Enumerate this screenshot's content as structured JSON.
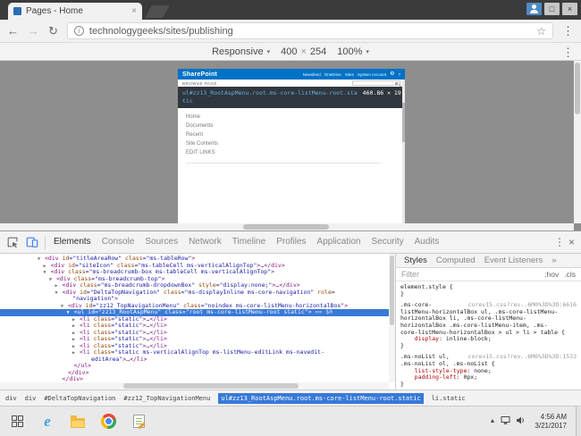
{
  "browser": {
    "tab_title": "Pages - Home",
    "tab_close": "×",
    "url": "technologygeeks/sites/publishing",
    "back": "←",
    "forward": "→",
    "reload": "↻",
    "info_glyph": "i",
    "star": "☆",
    "menu": "⋮",
    "maximize": "□",
    "close": "×"
  },
  "device_toolbar": {
    "mode": "Responsive",
    "caret": "▾",
    "width": "400",
    "times": "×",
    "height": "254",
    "zoom": "100%",
    "menu": "⋮"
  },
  "page": {
    "brand": "SharePoint",
    "suite_links": [
      "Newsfeed",
      "OneDrive",
      "Sites"
    ],
    "account": "System Account",
    "gear": "⚙",
    "help": "?",
    "ribbon_left": "BROWSE  PAGE",
    "nav_items": [
      "Home",
      "Documents",
      "Recent",
      "Site Contents",
      "EDIT LINKS"
    ],
    "tooltip": {
      "selector_line1": "ul#zz13_RootAspMenu.root.ms-core-listMenu-root.sta",
      "selector_line2": "tic",
      "dimensions": "460.86 × 19"
    }
  },
  "devtools": {
    "tabs": [
      "Elements",
      "Console",
      "Sources",
      "Network",
      "Timeline",
      "Profiles",
      "Application",
      "Security",
      "Audits"
    ],
    "selected_tab": "Elements",
    "menu": "⋮",
    "close": "×",
    "tree": [
      {
        "d": 0,
        "a": "▼",
        "s": [
          [
            "tg",
            "<div "
          ],
          [
            "at",
            "id"
          ],
          [
            "vl",
            "=\"titleAreaRow\""
          ],
          [
            "at",
            " class"
          ],
          [
            "vl",
            "=\"ms-tableRow\""
          ],
          [
            "tg",
            ">"
          ]
        ]
      },
      {
        "d": 1,
        "a": "▶",
        "s": [
          [
            "tg",
            "<div "
          ],
          [
            "at",
            "id"
          ],
          [
            "vl",
            "=\"siteIcon\""
          ],
          [
            "at",
            " class"
          ],
          [
            "vl",
            "=\"ms-tableCell ms-verticalAlignTop\""
          ],
          [
            "tg",
            ">"
          ],
          [
            "tx",
            "…"
          ],
          [
            "tg",
            "</div>"
          ]
        ]
      },
      {
        "d": 1,
        "a": "▼",
        "s": [
          [
            "tg",
            "<div "
          ],
          [
            "at",
            "class"
          ],
          [
            "vl",
            "=\"ms-breadcrumb-box ms-tableCell ms-verticalAlignTop\""
          ],
          [
            "tg",
            ">"
          ]
        ]
      },
      {
        "d": 2,
        "a": "▼",
        "s": [
          [
            "tg",
            "<div "
          ],
          [
            "at",
            "class"
          ],
          [
            "vl",
            "=\"ms-breadcrumb-top\""
          ],
          [
            "tg",
            ">"
          ]
        ]
      },
      {
        "d": 3,
        "a": "▶",
        "s": [
          [
            "tg",
            "<div "
          ],
          [
            "at",
            "class"
          ],
          [
            "vl",
            "=\"ms-breadcrumb-dropdownBox\""
          ],
          [
            "at",
            " style"
          ],
          [
            "vl",
            "=\"display:none;\""
          ],
          [
            "tg",
            ">"
          ],
          [
            "tx",
            "…"
          ],
          [
            "tg",
            "</div>"
          ]
        ]
      },
      {
        "d": 3,
        "a": "▼",
        "s": [
          [
            "tg",
            "<div "
          ],
          [
            "at",
            "id"
          ],
          [
            "vl",
            "=\"DeltaTopNavigation\""
          ],
          [
            "at",
            " class"
          ],
          [
            "vl",
            "=\"ms-displayInline ms-core-navigation\""
          ],
          [
            "at",
            " role"
          ],
          [
            "tx",
            "="
          ]
        ]
      },
      {
        "d": 4.8,
        "a": "",
        "s": [
          [
            "vl",
            "\"navigation\""
          ],
          [
            "tg",
            ">"
          ]
        ]
      },
      {
        "d": 4,
        "a": "▼",
        "s": [
          [
            "tg",
            "<div "
          ],
          [
            "at",
            "id"
          ],
          [
            "vl",
            "=\"zz12_TopNavigationMenu\""
          ],
          [
            "at",
            " class"
          ],
          [
            "vl",
            "=\"noindex ms-core-listMenu-horizontalBox\""
          ],
          [
            "tg",
            ">"
          ]
        ]
      },
      {
        "d": 5,
        "a": "▼",
        "sel": true,
        "s": [
          [
            "tg",
            "<ul "
          ],
          [
            "at",
            "id"
          ],
          [
            "vl",
            "=\"zz13_RootAspMenu\""
          ],
          [
            "at",
            " class"
          ],
          [
            "vl",
            "=\"root ms-core-listMenu-root static\""
          ],
          [
            "tg",
            ">"
          ],
          [
            "mk",
            " == $0"
          ]
        ]
      },
      {
        "d": 6,
        "a": "▶",
        "s": [
          [
            "tg",
            "<li "
          ],
          [
            "at",
            "class"
          ],
          [
            "vl",
            "=\"static\""
          ],
          [
            "tg",
            ">"
          ],
          [
            "tx",
            "…"
          ],
          [
            "tg",
            "</li>"
          ]
        ]
      },
      {
        "d": 6,
        "a": "▶",
        "s": [
          [
            "tg",
            "<li "
          ],
          [
            "at",
            "class"
          ],
          [
            "vl",
            "=\"static\""
          ],
          [
            "tg",
            ">"
          ],
          [
            "tx",
            "…"
          ],
          [
            "tg",
            "</li>"
          ]
        ]
      },
      {
        "d": 6,
        "a": "▶",
        "s": [
          [
            "tg",
            "<li "
          ],
          [
            "at",
            "class"
          ],
          [
            "vl",
            "=\"static\""
          ],
          [
            "tg",
            ">"
          ],
          [
            "tx",
            "…"
          ],
          [
            "tg",
            "</li>"
          ]
        ]
      },
      {
        "d": 6,
        "a": "▶",
        "s": [
          [
            "tg",
            "<li "
          ],
          [
            "at",
            "class"
          ],
          [
            "vl",
            "=\"static\""
          ],
          [
            "tg",
            ">"
          ],
          [
            "tx",
            "…"
          ],
          [
            "tg",
            "</li>"
          ]
        ]
      },
      {
        "d": 6,
        "a": "▶",
        "s": [
          [
            "tg",
            "<li "
          ],
          [
            "at",
            "class"
          ],
          [
            "vl",
            "=\"static\""
          ],
          [
            "tg",
            ">"
          ],
          [
            "tx",
            "…"
          ],
          [
            "tg",
            "</li>"
          ]
        ]
      },
      {
        "d": 6,
        "a": "▶",
        "s": [
          [
            "tg",
            "<li "
          ],
          [
            "at",
            "class"
          ],
          [
            "vl",
            "=\"static ms-verticalAlignTop ms-listMenu-editLink ms-navedit-"
          ]
        ]
      },
      {
        "d": 8,
        "a": "",
        "s": [
          [
            "vl",
            "editArea\""
          ],
          [
            "tg",
            ">"
          ],
          [
            "tx",
            "…"
          ],
          [
            "tg",
            "</li>"
          ]
        ]
      },
      {
        "d": 5,
        "a": "",
        "s": [
          [
            "tg",
            "</ul>"
          ]
        ]
      },
      {
        "d": 4,
        "a": "",
        "s": [
          [
            "tg",
            "</div>"
          ]
        ]
      },
      {
        "d": 3,
        "a": "",
        "s": [
          [
            "tg",
            "</div>"
          ]
        ]
      }
    ],
    "breadcrumbs": [
      {
        "label": "div"
      },
      {
        "label": "div"
      },
      {
        "label": "#DeltaTopNavigation"
      },
      {
        "label": "#zz12_TopNavigationMenu"
      },
      {
        "label": "ul#zz13_RootAspMenu.root.ms-core-listMenu-root.static",
        "selected": true
      },
      {
        "label": "li.static"
      }
    ],
    "styles": {
      "tabs": [
        "Styles",
        "Computed",
        "Event Listeners",
        "»"
      ],
      "selected_tab": "Styles",
      "filter_label": "Filter",
      "hov": ":hov",
      "cls": ".cls",
      "lines": [
        {
          "s": [
            [
              "cs",
              "element.style {"
            ]
          ]
        },
        {
          "s": [
            [
              "cs",
              "}"
            ]
          ]
        },
        {
          "gap": true
        },
        {
          "s": [
            [
              "cs",
              ".ms-core-"
            ]
          ],
          "link": "corev15.css?rev..6M0%3D%3D:6616"
        },
        {
          "s": [
            [
              "cs",
              "listMenu-horizontalBox ul, .ms-core-listMenu-"
            ]
          ]
        },
        {
          "s": [
            [
              "cs",
              "horizontalBox li, .ms-core-listMenu-"
            ]
          ]
        },
        {
          "s": [
            [
              "cs",
              "horizontalBox .ms-core-listMenu-item, .ms-"
            ]
          ]
        },
        {
          "s": [
            [
              "cs",
              "core-listMenu-horizontalBox > ul > li > table {"
            ]
          ]
        },
        {
          "s": [
            [
              "cs",
              "    "
            ],
            [
              "cp",
              "display"
            ],
            [
              "cs",
              ": "
            ],
            [
              "cv",
              "inline-block"
            ],
            [
              "cs",
              ";"
            ]
          ]
        },
        {
          "s": [
            [
              "cs",
              "}"
            ]
          ]
        },
        {
          "gap": true
        },
        {
          "s": [
            [
              "cs",
              ".ms-noList ul,"
            ]
          ],
          "link": "corev15.css?rev..6M0%3D%3D:1533"
        },
        {
          "s": [
            [
              "cs",
              ".ms-noList ol, .ms-noList {"
            ]
          ]
        },
        {
          "s": [
            [
              "cs",
              "    "
            ],
            [
              "cp",
              "list-style-type"
            ],
            [
              "cs",
              ": "
            ],
            [
              "cv",
              "none"
            ],
            [
              "cs",
              ";"
            ]
          ]
        },
        {
          "s": [
            [
              "cs",
              "    "
            ],
            [
              "cp",
              "padding-left"
            ],
            [
              "cs",
              ": "
            ],
            [
              "cv",
              "0px"
            ],
            [
              "cs",
              ";"
            ]
          ]
        },
        {
          "s": [
            [
              "cs",
              "}"
            ]
          ]
        }
      ]
    }
  },
  "taskbar": {
    "tray_caret": "▲",
    "time": "4:56 AM",
    "date": "3/21/2017"
  }
}
